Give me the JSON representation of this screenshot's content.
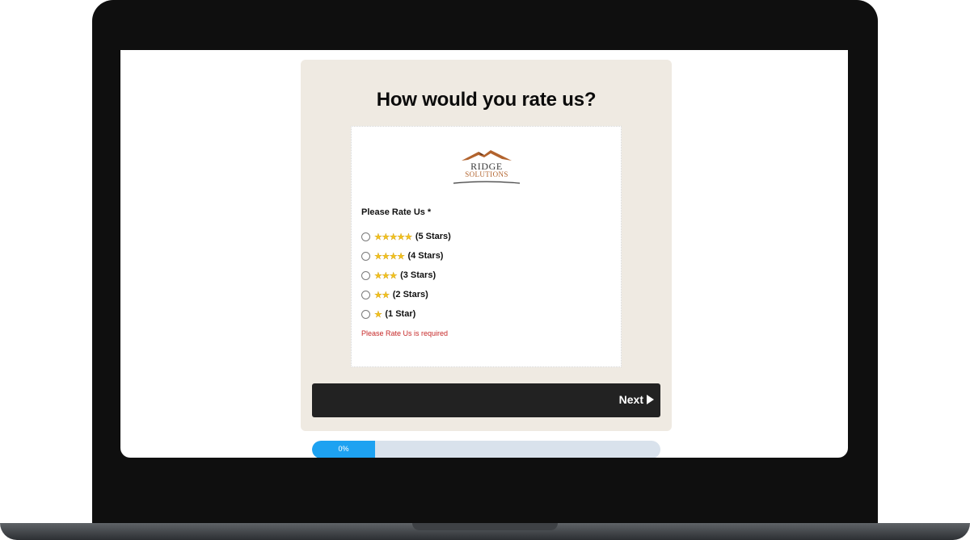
{
  "survey": {
    "title": "How would you rate us?",
    "logo": {
      "line1": "RIDGE",
      "line2": "SOLUTIONS"
    },
    "question_label": "Please Rate Us *",
    "options": [
      {
        "stars": "★★★★★",
        "label": "(5 Stars)"
      },
      {
        "stars": "★★★★",
        "label": "(4 Stars)"
      },
      {
        "stars": "★★★",
        "label": "(3 Stars)"
      },
      {
        "stars": "★★",
        "label": "(2 Stars)"
      },
      {
        "stars": "★",
        "label": "(1 Star)"
      }
    ],
    "error": "Please Rate Us is required",
    "next_label": "Next"
  },
  "progress": {
    "label": "0%",
    "fraction": 0.18
  },
  "colors": {
    "accent": "#1ea2f1",
    "card_bg": "#efeae2",
    "error": "#c62828",
    "button_bg": "#222222",
    "star": "#f3c31c"
  },
  "icons": {
    "next": "play-arrow-icon",
    "logo": "mountain-roof-icon"
  }
}
